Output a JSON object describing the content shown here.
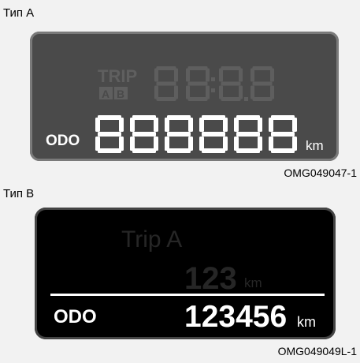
{
  "type_a": {
    "label": "Тип A",
    "trip_label": "TRIP",
    "trip_mode_a": "A",
    "trip_mode_b": "B",
    "odo_label": "ODO",
    "unit": "km",
    "code": "OMG049047-1"
  },
  "type_b": {
    "label": "Тип B",
    "trip_label": "Trip A",
    "trip_value": "123",
    "trip_unit": "km",
    "odo_label": "ODO",
    "odo_value": "123456",
    "odo_unit": "km",
    "code": "OMG049049L-1"
  },
  "colors": {
    "lcd_on": "#ffffff",
    "lcd_off_a": "#5e5e5e",
    "lcd_off_b": "#2a2a2a"
  }
}
